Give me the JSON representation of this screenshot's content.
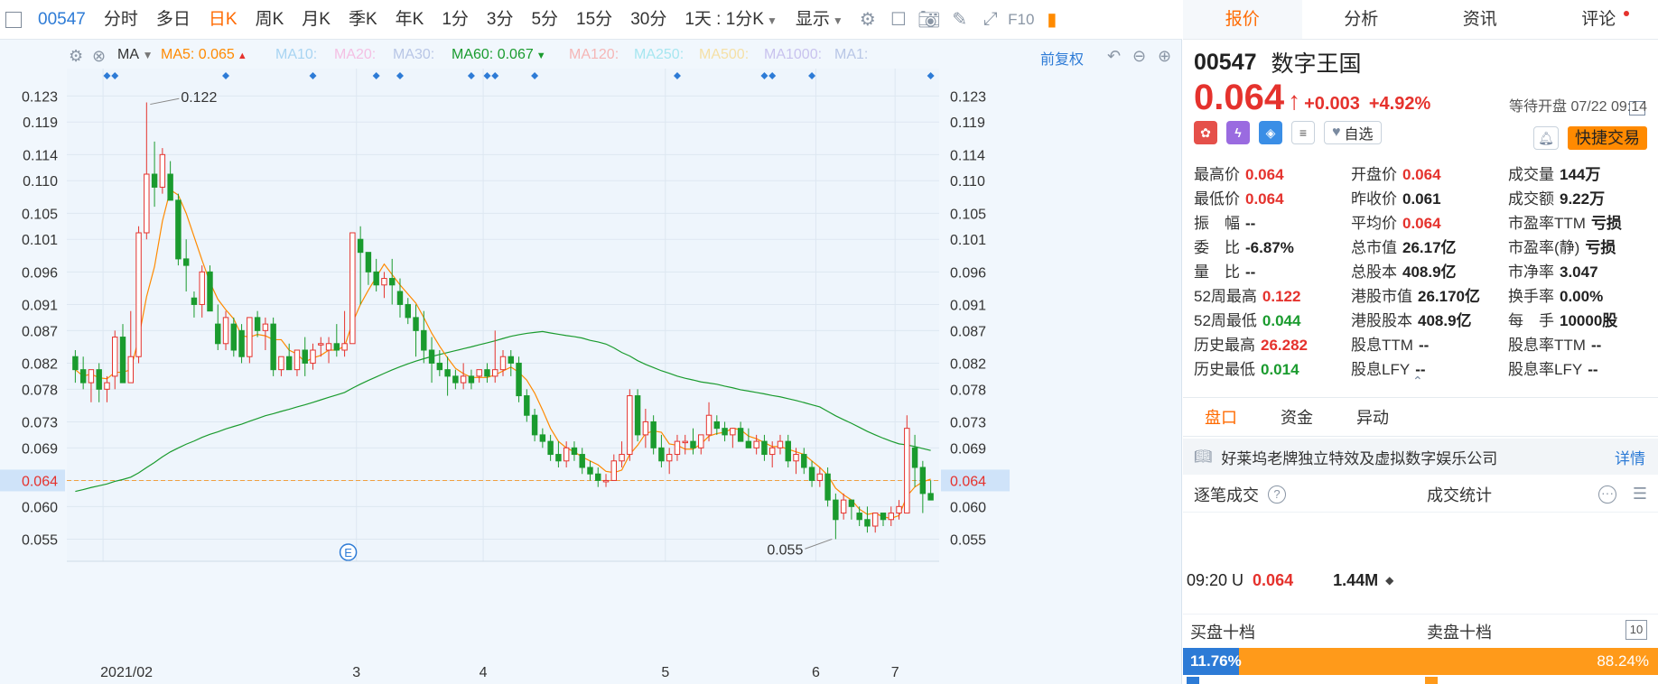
{
  "toolbar": {
    "code": "00547",
    "tabs": [
      "分时",
      "多日",
      "日K",
      "周K",
      "月K",
      "季K",
      "年K",
      "1分",
      "3分",
      "5分",
      "15分",
      "30分"
    ],
    "active_tab": "日K",
    "period_select": "1天 : 1分K",
    "display_select": "显示",
    "f10_label": "F10"
  },
  "ma_bar": {
    "type_select": "MA",
    "items": [
      {
        "label": "MA5:",
        "value": "0.065",
        "color": "#ff8a00",
        "x": 178,
        "arrow": "up"
      },
      {
        "label": "MA10:",
        "value": "",
        "color": "#a8d4f2",
        "x": 305
      },
      {
        "label": "MA20:",
        "value": "",
        "color": "#f4bfe3",
        "x": 370
      },
      {
        "label": "MA30:",
        "value": "",
        "color": "#b8c6e6",
        "x": 435
      },
      {
        "label": "MA60:",
        "value": "0.067",
        "color": "#1a9b2e",
        "x": 500,
        "arrow": "down"
      },
      {
        "label": "MA120:",
        "value": "",
        "color": "#f5b6b6",
        "x": 630
      },
      {
        "label": "MA250:",
        "value": "",
        "color": "#a6e6f0",
        "x": 702
      },
      {
        "label": "MA500:",
        "value": "",
        "color": "#f5e0a6",
        "x": 774
      },
      {
        "label": "MA1000:",
        "value": "",
        "color": "#c8c2ee",
        "x": 846
      },
      {
        "label": "MA1:",
        "value": "",
        "color": "#b8c6e6",
        "x": 924
      }
    ],
    "restore_label": "前复权"
  },
  "chart_data": {
    "type": "candlestick",
    "y_ticks": [
      "0.123",
      "0.119",
      "0.114",
      "0.110",
      "0.105",
      "0.101",
      "0.096",
      "0.091",
      "0.087",
      "0.082",
      "0.078",
      "0.073",
      "0.069",
      "0.064",
      "0.060",
      "0.055"
    ],
    "y_range": [
      0.0516,
      0.1272
    ],
    "x_labels": [
      "2021/02",
      "3",
      "4",
      "5",
      "6",
      "7"
    ],
    "current_price": "0.064",
    "high_marker": "0.122",
    "low_marker": "0.055",
    "event_marker": "E",
    "candles": [
      [
        0.083,
        0.084,
        0.079,
        0.081
      ],
      [
        0.081,
        0.083,
        0.078,
        0.079
      ],
      [
        0.079,
        0.081,
        0.076,
        0.081
      ],
      [
        0.081,
        0.082,
        0.076,
        0.078
      ],
      [
        0.078,
        0.08,
        0.076,
        0.079
      ],
      [
        0.08,
        0.087,
        0.078,
        0.086
      ],
      [
        0.086,
        0.088,
        0.082,
        0.079
      ],
      [
        0.079,
        0.09,
        0.079,
        0.083
      ],
      [
        0.083,
        0.103,
        0.082,
        0.102
      ],
      [
        0.102,
        0.122,
        0.101,
        0.111
      ],
      [
        0.111,
        0.116,
        0.106,
        0.109
      ],
      [
        0.109,
        0.115,
        0.108,
        0.114
      ],
      [
        0.111,
        0.113,
        0.108,
        0.107
      ],
      [
        0.107,
        0.108,
        0.097,
        0.098
      ],
      [
        0.098,
        0.101,
        0.093,
        0.097
      ],
      [
        0.092,
        0.093,
        0.089,
        0.091
      ],
      [
        0.091,
        0.097,
        0.089,
        0.096
      ],
      [
        0.096,
        0.097,
        0.09,
        0.09
      ],
      [
        0.088,
        0.091,
        0.084,
        0.085
      ],
      [
        0.085,
        0.09,
        0.084,
        0.089
      ],
      [
        0.088,
        0.089,
        0.083,
        0.084
      ],
      [
        0.087,
        0.088,
        0.082,
        0.083
      ],
      [
        0.083,
        0.089,
        0.082,
        0.089
      ],
      [
        0.089,
        0.09,
        0.086,
        0.087
      ],
      [
        0.087,
        0.089,
        0.084,
        0.088
      ],
      [
        0.088,
        0.089,
        0.08,
        0.081
      ],
      [
        0.081,
        0.083,
        0.08,
        0.083
      ],
      [
        0.083,
        0.085,
        0.082,
        0.081
      ],
      [
        0.081,
        0.084,
        0.08,
        0.084
      ],
      [
        0.084,
        0.086,
        0.08,
        0.082
      ],
      [
        0.082,
        0.085,
        0.081,
        0.084
      ],
      [
        0.085,
        0.086,
        0.083,
        0.085
      ],
      [
        0.084,
        0.086,
        0.082,
        0.085
      ],
      [
        0.085,
        0.088,
        0.083,
        0.084
      ],
      [
        0.084,
        0.09,
        0.083,
        0.085
      ],
      [
        0.085,
        0.102,
        0.085,
        0.102
      ],
      [
        0.101,
        0.103,
        0.091,
        0.099
      ],
      [
        0.099,
        0.099,
        0.094,
        0.096
      ],
      [
        0.096,
        0.098,
        0.093,
        0.094
      ],
      [
        0.094,
        0.096,
        0.092,
        0.095
      ],
      [
        0.095,
        0.098,
        0.091,
        0.094
      ],
      [
        0.093,
        0.095,
        0.089,
        0.091
      ],
      [
        0.091,
        0.092,
        0.088,
        0.089
      ],
      [
        0.089,
        0.091,
        0.083,
        0.087
      ],
      [
        0.087,
        0.09,
        0.082,
        0.084
      ],
      [
        0.084,
        0.086,
        0.079,
        0.082
      ],
      [
        0.082,
        0.084,
        0.08,
        0.081
      ],
      [
        0.081,
        0.083,
        0.077,
        0.08
      ],
      [
        0.08,
        0.081,
        0.078,
        0.079
      ],
      [
        0.079,
        0.082,
        0.078,
        0.08
      ],
      [
        0.08,
        0.081,
        0.078,
        0.079
      ],
      [
        0.08,
        0.081,
        0.079,
        0.081
      ],
      [
        0.081,
        0.082,
        0.079,
        0.08
      ],
      [
        0.08,
        0.087,
        0.079,
        0.081
      ],
      [
        0.081,
        0.084,
        0.08,
        0.083
      ],
      [
        0.083,
        0.084,
        0.08,
        0.082
      ],
      [
        0.082,
        0.083,
        0.076,
        0.077
      ],
      [
        0.077,
        0.078,
        0.073,
        0.074
      ],
      [
        0.074,
        0.075,
        0.07,
        0.071
      ],
      [
        0.071,
        0.072,
        0.069,
        0.07
      ],
      [
        0.07,
        0.071,
        0.067,
        0.068
      ],
      [
        0.068,
        0.07,
        0.066,
        0.067
      ],
      [
        0.067,
        0.07,
        0.066,
        0.069
      ],
      [
        0.069,
        0.07,
        0.067,
        0.068
      ],
      [
        0.068,
        0.069,
        0.065,
        0.066
      ],
      [
        0.066,
        0.067,
        0.064,
        0.065
      ],
      [
        0.065,
        0.066,
        0.063,
        0.064
      ],
      [
        0.064,
        0.065,
        0.063,
        0.064
      ],
      [
        0.064,
        0.068,
        0.064,
        0.067
      ],
      [
        0.067,
        0.07,
        0.066,
        0.068
      ],
      [
        0.068,
        0.078,
        0.067,
        0.077
      ],
      [
        0.077,
        0.078,
        0.07,
        0.071
      ],
      [
        0.071,
        0.075,
        0.069,
        0.073
      ],
      [
        0.073,
        0.074,
        0.068,
        0.069
      ],
      [
        0.069,
        0.071,
        0.066,
        0.067
      ],
      [
        0.067,
        0.069,
        0.065,
        0.068
      ],
      [
        0.068,
        0.071,
        0.067,
        0.07
      ],
      [
        0.07,
        0.071,
        0.068,
        0.07
      ],
      [
        0.07,
        0.072,
        0.068,
        0.069
      ],
      [
        0.069,
        0.071,
        0.068,
        0.071
      ],
      [
        0.071,
        0.076,
        0.07,
        0.074
      ],
      [
        0.073,
        0.074,
        0.071,
        0.072
      ],
      [
        0.072,
        0.073,
        0.07,
        0.071
      ],
      [
        0.071,
        0.072,
        0.069,
        0.072
      ],
      [
        0.072,
        0.073,
        0.07,
        0.07
      ],
      [
        0.07,
        0.072,
        0.069,
        0.069
      ],
      [
        0.069,
        0.071,
        0.068,
        0.07
      ],
      [
        0.07,
        0.071,
        0.067,
        0.068
      ],
      [
        0.068,
        0.07,
        0.066,
        0.069
      ],
      [
        0.069,
        0.071,
        0.068,
        0.07
      ],
      [
        0.07,
        0.071,
        0.066,
        0.067
      ],
      [
        0.067,
        0.069,
        0.065,
        0.068
      ],
      [
        0.068,
        0.069,
        0.065,
        0.066
      ],
      [
        0.066,
        0.067,
        0.063,
        0.064
      ],
      [
        0.064,
        0.066,
        0.063,
        0.065
      ],
      [
        0.065,
        0.066,
        0.06,
        0.061
      ],
      [
        0.061,
        0.062,
        0.055,
        0.058
      ],
      [
        0.059,
        0.062,
        0.058,
        0.061
      ],
      [
        0.061,
        0.061,
        0.058,
        0.06
      ],
      [
        0.059,
        0.06,
        0.057,
        0.058
      ],
      [
        0.058,
        0.06,
        0.056,
        0.057
      ],
      [
        0.057,
        0.059,
        0.056,
        0.059
      ],
      [
        0.059,
        0.059,
        0.057,
        0.058
      ],
      [
        0.058,
        0.06,
        0.057,
        0.059
      ],
      [
        0.059,
        0.061,
        0.058,
        0.06
      ],
      [
        0.059,
        0.074,
        0.059,
        0.072
      ],
      [
        0.069,
        0.071,
        0.063,
        0.066
      ],
      [
        0.066,
        0.067,
        0.059,
        0.062
      ],
      [
        0.062,
        0.064,
        0.061,
        0.061
      ]
    ],
    "ma5_color": "#ff8a00",
    "ma60_color": "#1a9b2e",
    "up_color": "#e5322d",
    "down_color": "#1a9b2e"
  },
  "quote": {
    "tabs": [
      "报价",
      "分析",
      "资讯",
      "评论"
    ],
    "active_tab": "报价",
    "code": "00547",
    "name": "数字王国",
    "price": "0.064",
    "change": "+0.003",
    "change_pct": "+4.92%",
    "status": "等待开盘 07/22 09:14",
    "watch_label": "自选",
    "trade_label": "快捷交易"
  },
  "stats": {
    "col1": [
      {
        "label": "最高价",
        "value": "0.064",
        "tone": "red"
      },
      {
        "label": "最低价",
        "value": "0.064",
        "tone": "red"
      },
      {
        "label": "振　幅",
        "value": "--",
        "tone": "dark"
      },
      {
        "label": "委　比",
        "value": "-6.87%",
        "tone": "dark"
      },
      {
        "label": "量　比",
        "value": "--",
        "tone": "dark"
      },
      {
        "label": "52周最高",
        "value": "0.122",
        "tone": "red"
      },
      {
        "label": "52周最低",
        "value": "0.044",
        "tone": "green"
      },
      {
        "label": "历史最高",
        "value": "26.282",
        "tone": "red"
      },
      {
        "label": "历史最低",
        "value": "0.014",
        "tone": "green"
      }
    ],
    "col2": [
      {
        "label": "开盘价",
        "value": "0.064",
        "tone": "red"
      },
      {
        "label": "昨收价",
        "value": "0.061",
        "tone": "dark"
      },
      {
        "label": "平均价",
        "value": "0.064",
        "tone": "red"
      },
      {
        "label": "总市值",
        "value": "26.17亿",
        "tone": "dark"
      },
      {
        "label": "总股本",
        "value": "408.9亿",
        "tone": "dark"
      },
      {
        "label": "港股市值",
        "value": "26.170亿",
        "tone": "dark"
      },
      {
        "label": "港股股本",
        "value": "408.9亿",
        "tone": "dark"
      },
      {
        "label": "股息TTM",
        "value": "--",
        "tone": "dark"
      },
      {
        "label": "股息LFY",
        "value": "--",
        "tone": "dark"
      }
    ],
    "col3": [
      {
        "label": "成交量",
        "value": "144万",
        "tone": "dark"
      },
      {
        "label": "成交额",
        "value": "9.22万",
        "tone": "dark"
      },
      {
        "label": "市盈率TTM",
        "value": "亏损",
        "tone": "dark"
      },
      {
        "label": "市盈率(静)",
        "value": "亏损",
        "tone": "dark"
      },
      {
        "label": "市净率",
        "value": "3.047",
        "tone": "dark"
      },
      {
        "label": "换手率",
        "value": "0.00%",
        "tone": "dark"
      },
      {
        "label": "每　手",
        "value": "10000股",
        "tone": "dark"
      },
      {
        "label": "股息率TTM",
        "value": "--",
        "tone": "dark"
      },
      {
        "label": "股息率LFY",
        "value": "--",
        "tone": "dark"
      }
    ]
  },
  "subtabs": [
    "盘口",
    "资金",
    "异动"
  ],
  "active_subtab": "盘口",
  "description": {
    "text": "好莱坞老牌独立特效及虚拟数字娱乐公司",
    "more": "详情"
  },
  "deals": {
    "title": "逐笔成交",
    "stats_title": "成交统计"
  },
  "tick": {
    "time": "09:20 U",
    "price": "0.064",
    "volume": "1.44M"
  },
  "orderbook": {
    "buy_label": "买盘十档",
    "sell_label": "卖盘十档",
    "ten_label": "10"
  },
  "ratio": {
    "buy_pct": "11.76%",
    "sell_pct": "88.24%",
    "buy_fraction": 0.1176
  }
}
